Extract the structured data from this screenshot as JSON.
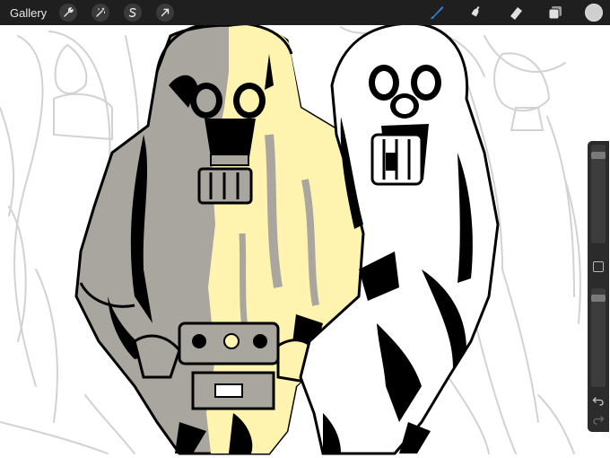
{
  "app": {
    "gallery_label": "Gallery"
  },
  "toolbar_left": {
    "icons": [
      "wrench-icon",
      "magic-wand-icon",
      "selection-s-icon",
      "transform-arrow-icon"
    ]
  },
  "toolbar_right": {
    "icons": [
      "brush-icon",
      "smudge-icon",
      "eraser-icon",
      "layers-icon"
    ],
    "active_tool": "brush-icon",
    "current_color": "#cfcfcf"
  },
  "sidebar": {
    "brush_size_level": 0.92,
    "opacity_level": 0.93,
    "icons": [
      "modify-square-icon",
      "undo-arrow-icon",
      "redo-arrow-icon"
    ]
  },
  "colors": {
    "accent": "#2f7fe8",
    "toolbar_bg": "#1f1f1f",
    "coat_gray": "#a9a6a0",
    "coat_yellow": "#fff3b0",
    "ink": "#000000",
    "sketch": "#d3d3d3"
  }
}
